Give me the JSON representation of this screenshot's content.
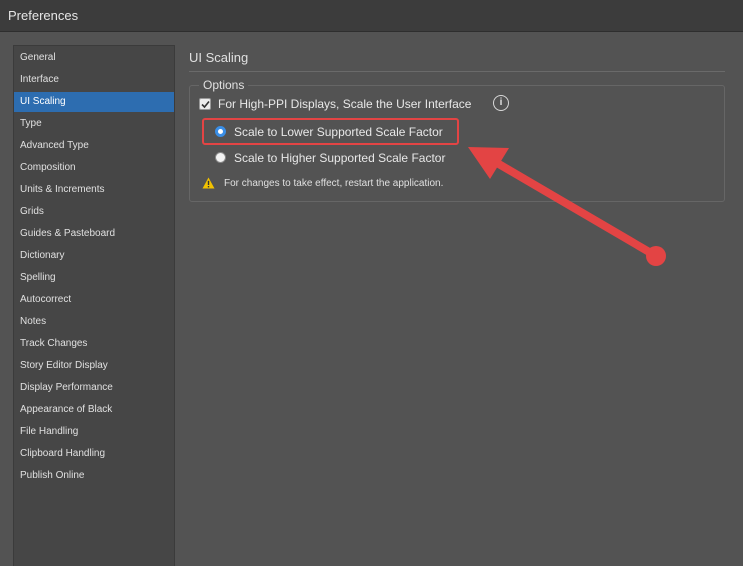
{
  "window": {
    "title": "Preferences"
  },
  "sidebar": {
    "selected_index": 2,
    "items": [
      {
        "label": "General"
      },
      {
        "label": "Interface"
      },
      {
        "label": "UI Scaling"
      },
      {
        "label": "Type"
      },
      {
        "label": "Advanced Type"
      },
      {
        "label": "Composition"
      },
      {
        "label": "Units & Increments"
      },
      {
        "label": "Grids"
      },
      {
        "label": "Guides & Pasteboard"
      },
      {
        "label": "Dictionary"
      },
      {
        "label": "Spelling"
      },
      {
        "label": "Autocorrect"
      },
      {
        "label": "Notes"
      },
      {
        "label": "Track Changes"
      },
      {
        "label": "Story Editor Display"
      },
      {
        "label": "Display Performance"
      },
      {
        "label": "Appearance of Black"
      },
      {
        "label": "File Handling"
      },
      {
        "label": "Clipboard Handling"
      },
      {
        "label": "Publish Online"
      }
    ]
  },
  "main": {
    "section_title": "UI Scaling",
    "options": {
      "group_label": "Options",
      "scale_checkbox": {
        "label": "For High-PPI Displays, Scale the User Interface",
        "checked": true
      },
      "radio_lower": {
        "label": "Scale to Lower Supported Scale Factor",
        "selected": true
      },
      "radio_higher": {
        "label": "Scale to Higher Supported Scale Factor",
        "selected": false
      },
      "warning": "For changes to take effect, restart the application."
    }
  },
  "icons": {
    "info": "info-icon",
    "warning": "warning-icon",
    "check": "checkmark-icon"
  },
  "colors": {
    "selection": "#2d6db0",
    "annotation": "#e34444",
    "radio_accent": "#3a8ee6",
    "warning": "#f2c200"
  }
}
